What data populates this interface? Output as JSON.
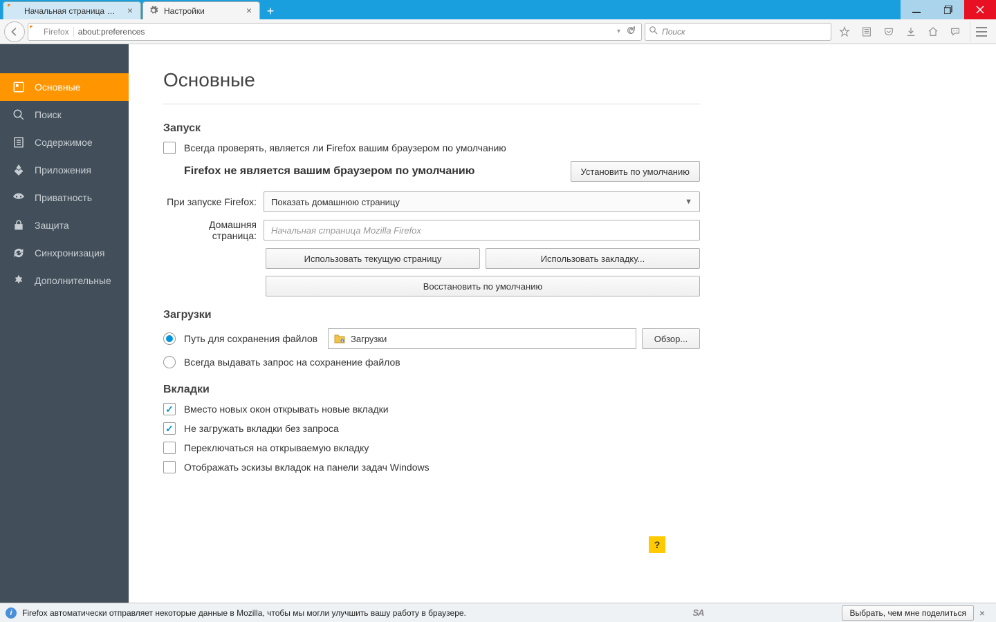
{
  "window": {
    "tabs": [
      {
        "label": "Начальная страница Мо...",
        "active": false
      },
      {
        "label": "Настройки",
        "active": true
      }
    ]
  },
  "urlbar": {
    "identity": "Firefox",
    "url": "about:preferences"
  },
  "searchbar": {
    "placeholder": "Поиск"
  },
  "sidebar": {
    "items": [
      {
        "label": "Основные"
      },
      {
        "label": "Поиск"
      },
      {
        "label": "Содержимое"
      },
      {
        "label": "Приложения"
      },
      {
        "label": "Приватность"
      },
      {
        "label": "Защита"
      },
      {
        "label": "Синхронизация"
      },
      {
        "label": "Дополнительные"
      }
    ]
  },
  "page": {
    "title": "Основные",
    "startup": {
      "heading": "Запуск",
      "always_check": "Всегда проверять, является ли Firefox вашим браузером по умолчанию",
      "not_default": "Firefox не является вашим браузером по умолчанию",
      "make_default_btn": "Установить по умолчанию",
      "on_start_label": "При запуске Firefox:",
      "on_start_value": "Показать домашнюю страницу",
      "homepage_label": "Домашняя страница:",
      "homepage_placeholder": "Начальная страница Mozilla Firefox",
      "use_current": "Использовать текущую страницу",
      "use_bookmark": "Использовать закладку...",
      "restore_default": "Восстановить по умолчанию"
    },
    "downloads": {
      "heading": "Загрузки",
      "save_to": "Путь для сохранения файлов",
      "path": "Загрузки",
      "browse": "Обзор...",
      "always_ask": "Всегда выдавать запрос на сохранение файлов"
    },
    "tabs": {
      "heading": "Вкладки",
      "open_in_tabs": "Вместо новых окон открывать новые вкладки",
      "dont_load": "Не загружать вкладки без запроса",
      "switch_to": "Переключаться на открываемую вкладку",
      "show_previews": "Отображать эскизы вкладок на панели задач Windows"
    },
    "help": "?"
  },
  "notify": {
    "text": "Firefox автоматически отправляет некоторые данные в Mozilla, чтобы мы могли улучшить вашу работу в браузере.",
    "sa": "SA",
    "button": "Выбрать, чем мне поделиться"
  }
}
